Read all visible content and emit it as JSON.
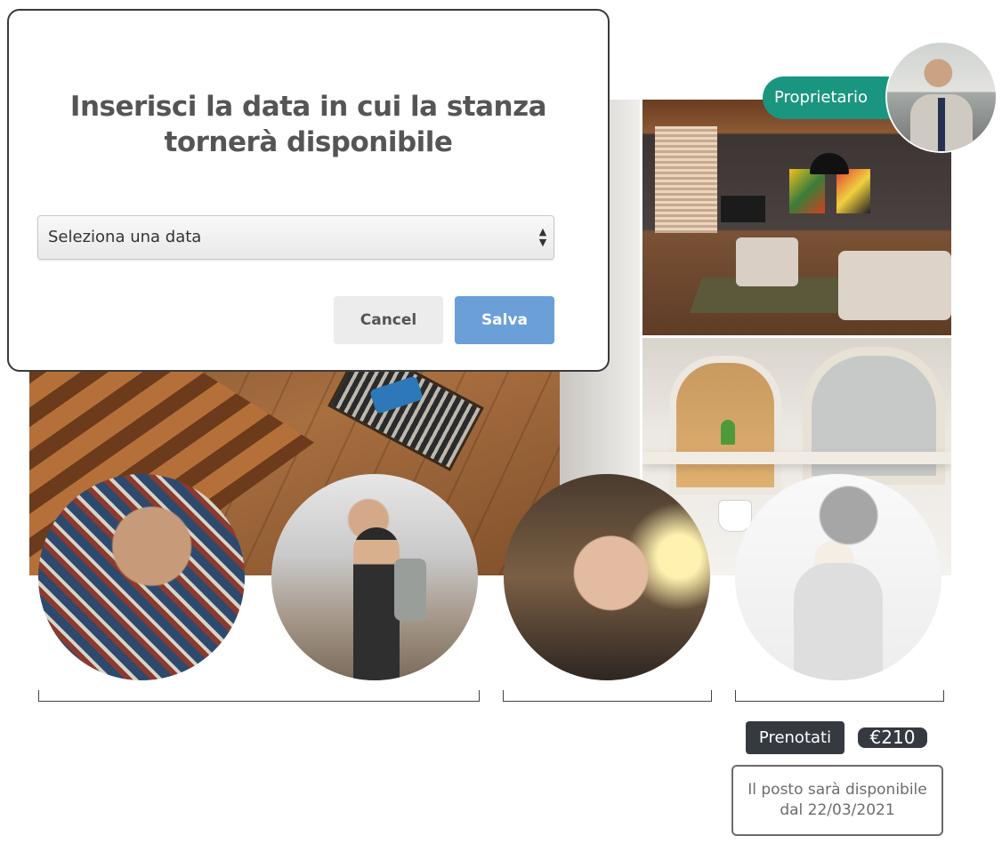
{
  "owner": {
    "badge_label": "Proprietario",
    "avatar_icon": "owner-avatar"
  },
  "gallery": {
    "images": [
      "main-room-photo",
      "living-room-photo",
      "bathroom-photo"
    ]
  },
  "roommates": {
    "avatars": [
      "roommate-1",
      "roommate-2",
      "roommate-3",
      "roommate-4-faded"
    ]
  },
  "booking": {
    "book_label": "Prenotati",
    "price": "€210",
    "availability_line1": "Il posto sarà disponibile",
    "availability_line2": "dal 22/03/2021"
  },
  "modal": {
    "title": "Inserisci la data in cui la stanza tornerà disponibile",
    "select_placeholder": "Seleziona una data",
    "cancel_label": "Cancel",
    "save_label": "Salva"
  },
  "colors": {
    "owner_badge": "#1a9680",
    "dark_button": "#343a40",
    "save_button": "#6a9fd8",
    "cancel_button": "#ececec"
  }
}
